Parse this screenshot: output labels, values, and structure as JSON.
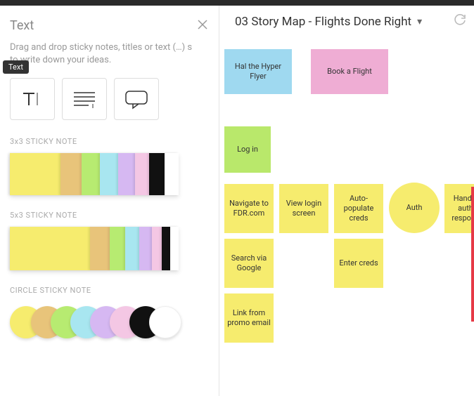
{
  "panel": {
    "title": "Text",
    "description": "Drag and drop sticky notes, titles or text (…) s to write down your ideas.",
    "tooltip": "Text",
    "tools": {
      "text": "Text tool",
      "paragraph": "Paragraph tool",
      "comment": "Comment tool"
    },
    "sections": {
      "sticky3x3": "3x3 STICKY NOTE",
      "sticky5x3": "5x3 STICKY NOTE",
      "circle": "CIRCLE STICKY NOTE"
    }
  },
  "colors": {
    "yellow": "#f6ec6e",
    "orange": "#e8c47a",
    "green": "#b7eb71",
    "cyan": "#a8e6f0",
    "purple": "#d6b8f2",
    "pink": "#f4c7e4",
    "black": "#111111",
    "white": "#ffffff"
  },
  "canvas": {
    "title": "03 Story Map - Flights Done Right"
  },
  "notes": {
    "persona": {
      "label": "Hal the Hyper Flyer",
      "color": "#9fd9f0"
    },
    "book": {
      "label": "Book a Flight",
      "color": "#efadd4"
    },
    "login": {
      "label": "Log in",
      "color": "#b9e86b"
    },
    "nav": {
      "label": "Navigate to FDR.com",
      "color": "#f6ec6e"
    },
    "view": {
      "label": "View login screen",
      "color": "#f6ec6e"
    },
    "auto": {
      "label": "Auto-populate creds",
      "color": "#f6ec6e"
    },
    "auth": {
      "label": "Auth",
      "color": "#f6ec6e"
    },
    "handle": {
      "label": "Handle auth respons",
      "color": "#f6ec6e"
    },
    "search": {
      "label": "Search via Google",
      "color": "#f6ec6e"
    },
    "enter": {
      "label": "Enter creds",
      "color": "#f6ec6e"
    },
    "link": {
      "label": "Link from promo email",
      "color": "#f6ec6e"
    }
  }
}
